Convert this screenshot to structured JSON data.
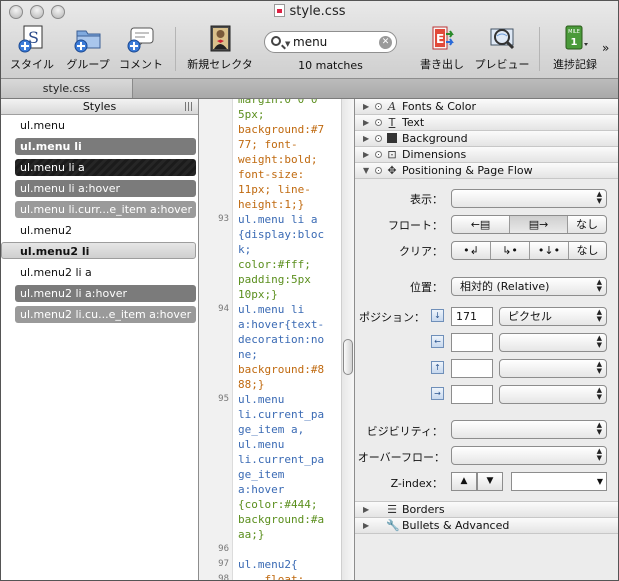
{
  "window": {
    "title": "style.css"
  },
  "toolbar": {
    "items": [
      {
        "label": "スタイル",
        "icon": "style-icon"
      },
      {
        "label": "グループ",
        "icon": "group-icon"
      },
      {
        "label": "コメント",
        "icon": "comment-icon"
      },
      {
        "label": "新規セレクタ",
        "icon": "new-selector-icon"
      },
      {
        "label": "書き出し",
        "icon": "export-icon"
      },
      {
        "label": "プレビュー",
        "icon": "preview-icon"
      },
      {
        "label": "進捗記録",
        "icon": "milestone-icon"
      }
    ],
    "milestone_badge_top": "MILE",
    "milestone_badge_num": "1",
    "search_value": "menu",
    "matches": "10 matches"
  },
  "tab": {
    "label": "style.css"
  },
  "styles": {
    "header": "Styles",
    "items": [
      "ul.menu",
      "ul.menu li",
      "ul.menu li a",
      "ul.menu li a:hover",
      "ul.menu li.curr...e_item a:hover",
      "ul.menu2",
      "ul.menu2 li",
      "ul.menu2 li a",
      "ul.menu2 li a:hover",
      "ul.menu2 li.cu...e_item a:hover"
    ]
  },
  "code": {
    "line_numbers": [
      "93",
      "94",
      "95",
      "96",
      "97",
      "98"
    ],
    "lines": [
      "margin:0 0 0",
      "5px;",
      "background:#7",
      "77; font-",
      "weight:bold;",
      "font-size:",
      "11px; line-",
      "height:1;}",
      "ul.menu li a",
      "{display:bloc",
      "k;",
      "color:#fff;",
      "padding:5px",
      "10px;}",
      "ul.menu li",
      "a:hover{text-",
      "decoration:no",
      "ne;",
      "background:#8",
      "88;}",
      "ul.menu",
      "li.current_pa",
      "ge_item a,",
      "ul.menu",
      "li.current_pa",
      "ge_item",
      "a:hover",
      "{color:#444;",
      "background:#a",
      "aa;}",
      "",
      "ul.menu2{",
      "    float:"
    ]
  },
  "inspector": {
    "sections_top": [
      {
        "label": "Fonts & Color",
        "icon": "font-icon"
      },
      {
        "label": "Text",
        "icon": "text-icon"
      },
      {
        "label": "Background",
        "icon": "background-icon"
      },
      {
        "label": "Dimensions",
        "icon": "dimensions-icon"
      },
      {
        "label": "Positioning & Page Flow",
        "icon": "positioning-icon"
      }
    ],
    "display_label": "表示：",
    "float_label": "フロート：",
    "float_none": "なし",
    "clear_label": "クリア：",
    "clear_none": "なし",
    "position_label": "位置：",
    "position_value": "相対的 (Relative)",
    "offset_label": "ポジション：",
    "top_value": "171",
    "top_unit": "ピクセル",
    "visibility_label": "ビジビリティ：",
    "overflow_label": "オーバーフロー：",
    "zindex_label": "Z-index：",
    "sections_bottom": [
      {
        "label": "Borders",
        "icon": "borders-icon"
      },
      {
        "label": "Bullets & Advanced",
        "icon": "wrench-icon"
      }
    ]
  }
}
